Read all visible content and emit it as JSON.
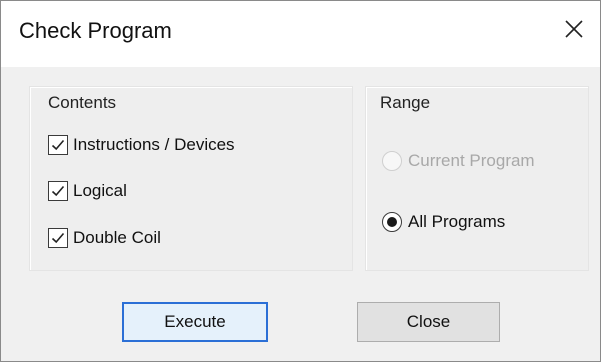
{
  "window": {
    "title": "Check Program",
    "close_icon": "close-icon"
  },
  "contents": {
    "title": "Contents",
    "items": [
      {
        "label": "Instructions / Devices",
        "checked": true
      },
      {
        "label": "Logical",
        "checked": true
      },
      {
        "label": "Double Coil",
        "checked": true
      }
    ]
  },
  "range": {
    "title": "Range",
    "options": [
      {
        "label": "Current Program",
        "selected": false,
        "enabled": false
      },
      {
        "label": "All Programs",
        "selected": true,
        "enabled": true
      }
    ]
  },
  "buttons": {
    "execute_label": "Execute",
    "close_label": "Close"
  },
  "colors": {
    "default_button_border": "#2b6fd6",
    "disabled_text": "#a8a8a8"
  }
}
